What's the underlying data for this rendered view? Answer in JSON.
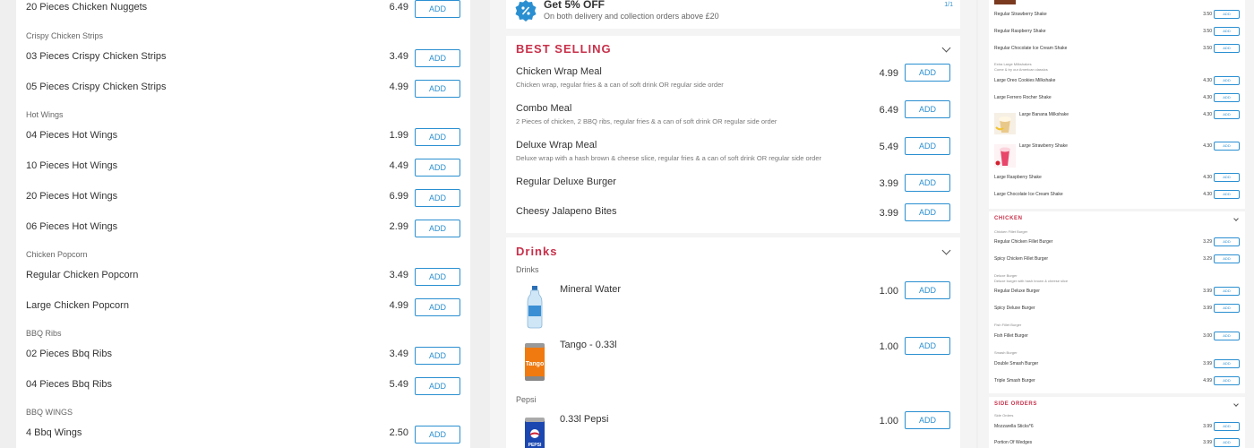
{
  "add_label": "ADD",
  "colors": {
    "accent": "#c8304a",
    "button": "#2a8fd1"
  },
  "left": {
    "items": [
      {
        "name": "20 Pieces Chicken Nuggets",
        "price": "6.49"
      },
      {
        "name": "03 Pieces Crispy Chicken Strips",
        "price": "3.49"
      },
      {
        "name": "05 Pieces Crispy Chicken Strips",
        "price": "4.99"
      },
      {
        "name": "04 Pieces Hot Wings",
        "price": "1.99"
      },
      {
        "name": "10 Pieces Hot Wings",
        "price": "4.49"
      },
      {
        "name": "20 Pieces Hot Wings",
        "price": "6.99"
      },
      {
        "name": "06 Pieces Hot Wings",
        "price": "2.99"
      },
      {
        "name": "Regular Chicken Popcorn",
        "price": "3.49"
      },
      {
        "name": "Large Chicken Popcorn",
        "price": "4.99"
      },
      {
        "name": "02 Pieces Bbq Ribs",
        "price": "3.49"
      },
      {
        "name": "04 Pieces Bbq Ribs",
        "price": "5.49"
      },
      {
        "name": "4 Bbq Wings",
        "price": "2.50"
      }
    ],
    "categories": [
      "Crispy Chicken Strips",
      "Hot Wings",
      "Chicken Popcorn",
      "BBQ Ribs",
      "BBQ WINGS"
    ]
  },
  "promo": {
    "title": "Get 5% OFF",
    "subtitle": "On both delivery and collection orders above £20",
    "pager": "1/1",
    "icon": "percent-badge-icon"
  },
  "best_selling": {
    "title": "BEST SELLING",
    "items": [
      {
        "name": "Chicken Wrap Meal",
        "desc": "Chicken wrap, regular fries & a can of soft drink OR regular side order",
        "price": "4.99"
      },
      {
        "name": "Combo Meal",
        "desc": "2 Pieces of chicken, 2 BBQ ribs, regular fries & a can of soft drink OR regular side order",
        "price": "6.49"
      },
      {
        "name": "Deluxe Wrap Meal",
        "desc": "Deluxe wrap with a hash brown & cheese slice, regular fries & a can of soft drink OR regular side order",
        "price": "5.49"
      },
      {
        "name": "Regular Deluxe Burger",
        "desc": "",
        "price": "3.99"
      },
      {
        "name": "Cheesy Jalapeno Bites",
        "desc": "",
        "price": "3.99"
      }
    ]
  },
  "drinks": {
    "title": "Drinks",
    "subcat_drinks": "Drinks",
    "subcat_pepsi": "Pepsi",
    "items": [
      {
        "name": "Mineral Water",
        "price": "1.00",
        "icon": "water-bottle-icon"
      },
      {
        "name": "Tango - 0.33l",
        "price": "1.00",
        "icon": "tango-can-icon",
        "can_text": "Tango"
      },
      {
        "name": "0.33l Pepsi",
        "price": "1.00",
        "icon": "pepsi-can-icon",
        "can_text": "PEPSI"
      }
    ]
  },
  "right": {
    "shakes_top": [
      {
        "name": "Regular Strawberry Shake",
        "price": "3.50"
      },
      {
        "name": "Regular Raspberry Shake",
        "price": "3.50"
      },
      {
        "name": "Regular Chocolate Ice Cream Shake",
        "price": "3.50"
      }
    ],
    "large_cat": "Extra Large Milkshakes",
    "large_cat_desc": "Come & try our American classics",
    "shakes_large": [
      {
        "name": "Large Oreo Cookies Milkshake",
        "price": "4.30"
      },
      {
        "name": "Large Ferrero Rocher Shake",
        "price": "4.30"
      },
      {
        "name": "Large Banana Milkshake",
        "price": "4.30"
      },
      {
        "name": "Large Strawberry Shake",
        "price": "4.30"
      },
      {
        "name": "Large Raspberry Shake",
        "price": "4.30"
      },
      {
        "name": "Large Chocolate Ice Cream Shake",
        "price": "4.30"
      }
    ],
    "chicken_title": "CHICKEN",
    "chicken_groups": [
      {
        "cat": "Chicken Fillet Burger",
        "desc": "",
        "items": [
          {
            "name": "Regular Chicken Fillet Burger",
            "price": "3.29"
          },
          {
            "name": "Spicy Chicken Fillet Burger",
            "price": "3.29"
          }
        ]
      },
      {
        "cat": "Deluxe Burger",
        "desc": "Deluxe burger with hash brown & cheese slice",
        "items": [
          {
            "name": "Regular Deluxe Burger",
            "price": "3.99"
          },
          {
            "name": "Spicy Deluxe Burger",
            "price": "3.99"
          }
        ]
      },
      {
        "cat": "Fish Fillet Burger",
        "desc": "",
        "items": [
          {
            "name": "Fish Fillet Burger",
            "price": "3.00"
          }
        ]
      },
      {
        "cat": "Smash Burger",
        "desc": "",
        "items": [
          {
            "name": "Double Smash Burger",
            "price": "3.99"
          },
          {
            "name": "Triple Smash Burger",
            "price": "4.99"
          }
        ]
      }
    ],
    "side_title": "SIDE ORDERS",
    "side_cat": "Side Orders",
    "side_items": [
      {
        "name": "Mozzarella Sticks*6",
        "price": "3.99"
      },
      {
        "name": "Portion Of Wedges",
        "price": "3.99"
      }
    ]
  }
}
